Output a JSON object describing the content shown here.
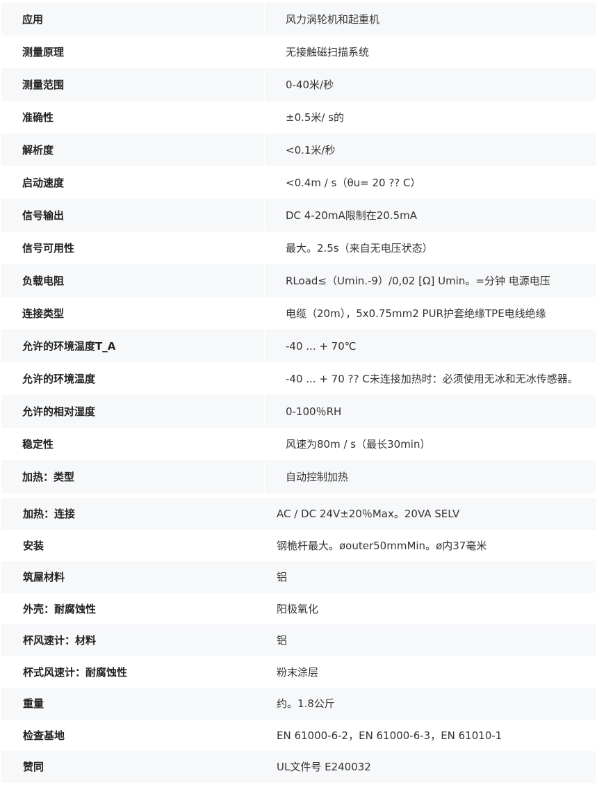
{
  "section_a": [
    {
      "label": "应用",
      "value": "风力涡轮机和起重机"
    },
    {
      "label": "测量原理",
      "value": "无接触磁扫描系统"
    },
    {
      "label": "测量范围",
      "value": "0-40米/秒"
    },
    {
      "label": "准确性",
      "value": "±0.5米/ s的"
    },
    {
      "label": "解析度",
      "value": "<0.1米/秒"
    },
    {
      "label": "启动速度",
      "value": "<0.4m / s（θu= 20 ?? C）"
    },
    {
      "label": "信号输出",
      "value": "DC 4-20mA限制在20.5mA"
    },
    {
      "label": "信号可用性",
      "value": "最大。2.5s（来自无电压状态）"
    },
    {
      "label": "负载电阻",
      "value": "RLoad≤（Umin.-9）/0,02 [Ω] Umin。=分钟 电源电压"
    },
    {
      "label": "连接类型",
      "value": "电缆（20m），5x0.75mm2 PUR护套绝缘TPE电线绝缘"
    },
    {
      "label": "允许的环境温度T_A",
      "value": "-40 ... + 70℃"
    },
    {
      "label": "允许的环境温度",
      "value": "-40 ... + 70 ?? C未连接加热时：必须使用无冰和无冰传感器。"
    },
    {
      "label": "允许的相对湿度",
      "value": "0-100％RH"
    },
    {
      "label": "稳定性",
      "value": "风速为80m / s（最长30min）"
    },
    {
      "label": "加热：类型",
      "value": "自动控制加热"
    }
  ],
  "section_b": [
    {
      "label": "加热：连接",
      "value": "AC / DC 24V±20％Max。20VA SELV"
    },
    {
      "label": "安装",
      "value": "钢桅杆最大。øouter50mmMin。ø内37毫米"
    },
    {
      "label": "筑屋材料",
      "value": "铝"
    },
    {
      "label": "外壳：耐腐蚀性",
      "value": "阳极氧化"
    },
    {
      "label": "杯风速计：材料",
      "value": "铝"
    },
    {
      "label": "杯式风速计：耐腐蚀性",
      "value": "粉末涂层"
    },
    {
      "label": "重量",
      "value": "约。1.8公斤"
    },
    {
      "label": "检查基地",
      "value": "EN 61000-6-2，EN 61000-6-3，EN 61010-1"
    },
    {
      "label": "赞同",
      "value": "UL文件号 E240032"
    }
  ]
}
